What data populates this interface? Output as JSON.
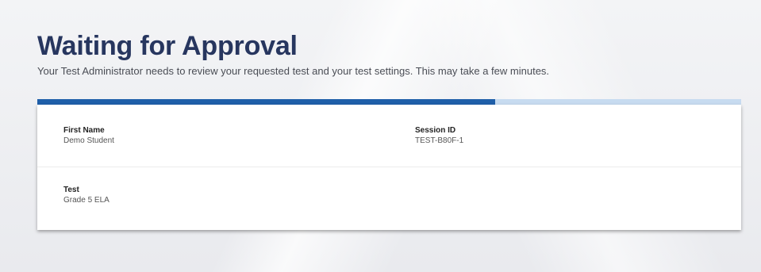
{
  "page": {
    "title": "Waiting for Approval",
    "subtitle": "Your Test Administrator needs to review your requested test and your test settings. This may take a few minutes.",
    "progress_fraction": 0.65
  },
  "details": {
    "first_name": {
      "label": "First Name",
      "value": "Demo Student"
    },
    "session_id": {
      "label": "Session ID",
      "value": "TEST-B80F-1"
    },
    "test": {
      "label": "Test",
      "value": "Grade 5 ELA"
    }
  },
  "colors": {
    "title": "#27365f",
    "progress_fill": "#1f5fa9",
    "progress_track": "#c7dbf0"
  }
}
